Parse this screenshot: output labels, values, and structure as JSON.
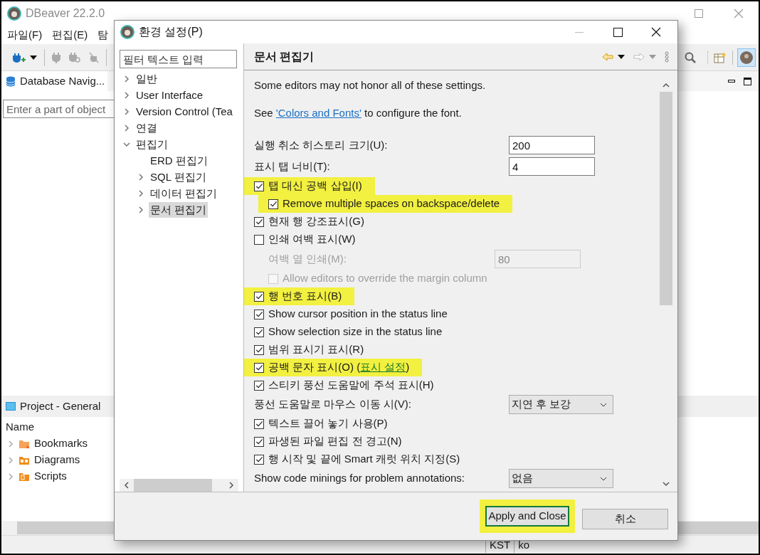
{
  "main_window": {
    "title": "DBeaver 22.2.0",
    "menu": [
      "파일(F)",
      "편집(E)",
      "탐"
    ],
    "navigator": {
      "tab": "Database Navig...",
      "filter_placeholder": "Enter a part of object"
    },
    "project": {
      "tab": "Project - General",
      "column": "Name",
      "items": [
        {
          "label": "Bookmarks",
          "kind": "bookmarks"
        },
        {
          "label": "Diagrams",
          "kind": "diagrams"
        },
        {
          "label": "Scripts",
          "kind": "scripts"
        }
      ]
    },
    "status_bar": [
      "KST",
      "ko"
    ]
  },
  "dialog": {
    "title": "환경 설정(P)",
    "filter_placeholder": "필터 텍스트 입력",
    "tree": [
      {
        "label": "일반",
        "kind": "folder",
        "expanded": false,
        "selected": false
      },
      {
        "label": "User Interface",
        "kind": "folder",
        "expanded": false,
        "selected": false
      },
      {
        "label": "Version Control (Tea",
        "kind": "folder",
        "expanded": false,
        "selected": false
      },
      {
        "label": "연결",
        "kind": "folder",
        "expanded": false,
        "selected": false
      },
      {
        "label": "편집기",
        "kind": "folder",
        "expanded": true,
        "selected": false,
        "children": [
          {
            "label": "ERD 편집기",
            "kind": "leaf",
            "selected": false
          },
          {
            "label": "SQL 편집기",
            "kind": "folder",
            "expanded": false,
            "selected": false
          },
          {
            "label": "데이터 편집기",
            "kind": "folder",
            "expanded": false,
            "selected": false
          },
          {
            "label": "문서 편집기",
            "kind": "folder",
            "expanded": false,
            "selected": true
          }
        ]
      }
    ],
    "page_title": "문서 편집기",
    "settings": [
      {
        "kind": "note",
        "text": "Some editors may not honor all of these settings."
      },
      {
        "kind": "link_note",
        "before": "See ",
        "link": "'Colors and Fonts'",
        "after": " to configure the font."
      },
      {
        "kind": "number",
        "label": "실행 취소 히스토리 크기(U):",
        "value": "200",
        "disabled": false
      },
      {
        "kind": "number",
        "label": "표시 탭 너비(T):",
        "value": "4",
        "disabled": false
      },
      {
        "kind": "checkbox",
        "label": "탭 대신 공백 삽입(I)",
        "checked": true,
        "disabled": false,
        "highlighted": true,
        "children": [
          {
            "kind": "checkbox",
            "label": "Remove multiple spaces on backspace/delete",
            "checked": true,
            "disabled": false,
            "highlighted": true
          }
        ]
      },
      {
        "kind": "checkbox",
        "label": "현재 행 강조표시(G)",
        "checked": true,
        "disabled": false,
        "highlighted": false
      },
      {
        "kind": "checkbox",
        "label": "인쇄 여백 표시(W)",
        "checked": false,
        "disabled": false,
        "highlighted": false,
        "children": [
          {
            "kind": "number",
            "label": "여백 열 인쇄(M):",
            "value": "80",
            "disabled": true
          },
          {
            "kind": "checkbox",
            "label": "Allow editors to override the margin column",
            "checked": false,
            "disabled": true,
            "highlighted": false
          }
        ]
      },
      {
        "kind": "checkbox",
        "label": "행 번호 표시(B)",
        "checked": true,
        "disabled": false,
        "highlighted": true
      },
      {
        "kind": "checkbox",
        "label": "Show cursor position in the status line",
        "checked": true,
        "disabled": false,
        "highlighted": false
      },
      {
        "kind": "checkbox",
        "label": "Show selection size in the status line",
        "checked": true,
        "disabled": false,
        "highlighted": false
      },
      {
        "kind": "checkbox",
        "label": "범위 표시기 표시(R)",
        "checked": true,
        "disabled": false,
        "highlighted": false
      },
      {
        "kind": "checkbox",
        "label": "공백 문자 표시(O) (",
        "link": "표시 설정",
        "label_after": ")",
        "checked": true,
        "disabled": false,
        "highlighted": true
      },
      {
        "kind": "checkbox",
        "label": "스티키 풍선 도움말에 주석 표시(H)",
        "checked": true,
        "disabled": false,
        "highlighted": false
      },
      {
        "kind": "select",
        "label": "풍선 도움말로 마우스 이동 시(V):",
        "value": "지연 후 보강"
      },
      {
        "kind": "checkbox",
        "label": "텍스트 끌어 놓기 사용(P)",
        "checked": true,
        "disabled": false,
        "highlighted": false
      },
      {
        "kind": "checkbox",
        "label": "파생된 파일 편집 전 경고(N)",
        "checked": true,
        "disabled": false,
        "highlighted": false
      },
      {
        "kind": "checkbox",
        "label": "행 시작 및 끝에 Smart 캐럿 위치 지정(S)",
        "checked": true,
        "disabled": false,
        "highlighted": false
      },
      {
        "kind": "select",
        "label": "Show code minings for problem annotations:",
        "value": "없음"
      }
    ],
    "buttons": [
      {
        "label": "Apply and Close",
        "default": true,
        "highlighted": true
      },
      {
        "label": "취소",
        "default": false,
        "highlighted": false
      }
    ]
  }
}
